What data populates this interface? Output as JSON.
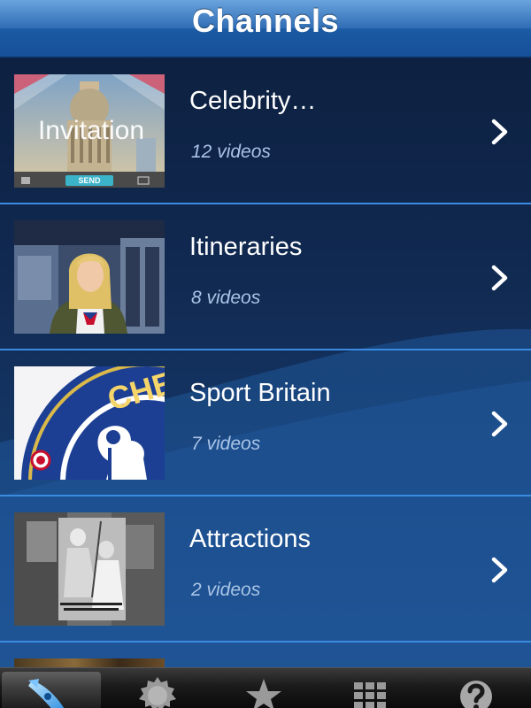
{
  "nav": {
    "title": "Channels"
  },
  "channels": [
    {
      "title": "Celebrity…",
      "count": "12 videos",
      "thumbnail_icon": "invitation-thumbnail",
      "thumbnail_caption": "Invitation",
      "thumbnail_button": "SEND"
    },
    {
      "title": "Itineraries",
      "count": "8 videos",
      "thumbnail_icon": "presenter-thumbnail"
    },
    {
      "title": "Sport Britain",
      "count": "7 videos",
      "thumbnail_icon": "chelsea-crest-thumbnail",
      "thumbnail_crest_text": "CHELS"
    },
    {
      "title": "Attractions",
      "count": "2 videos",
      "thumbnail_icon": "vintage-photo-thumbnail"
    }
  ],
  "tabs": [
    {
      "icon": "rocket-icon",
      "active": true
    },
    {
      "icon": "badge-icon",
      "active": false
    },
    {
      "icon": "star-icon",
      "active": false
    },
    {
      "icon": "grid-icon",
      "active": false
    },
    {
      "icon": "help-icon",
      "active": false
    }
  ],
  "colors": {
    "nav_bar": "#2f6db5",
    "row_divider": "#3b8be0",
    "subtitle_text": "#a9c4e6",
    "tab_bar": "#1a1a1a"
  }
}
